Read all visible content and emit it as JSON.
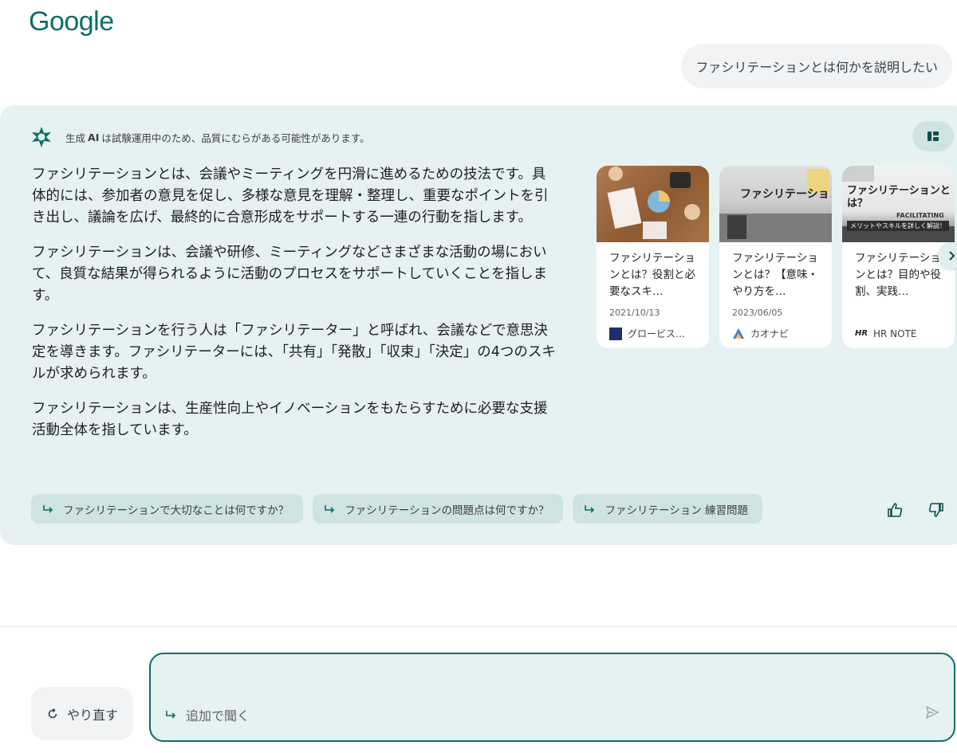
{
  "brand": {
    "logo_text": "Google",
    "accent": "#0b6e6a",
    "panel_bg": "#e6f1f1"
  },
  "user_query": "ファシリテーションとは何かを説明したい",
  "notice": {
    "icon": "sparkle-icon",
    "prefix": "生成",
    "bold": "AI",
    "suffix": "は試験運用中のため、品質にむらがある可能性があります。"
  },
  "answer": {
    "paragraphs": [
      "ファシリテーションとは、会議やミーティングを円滑に進めるための技法です。具体的には、参加者の意見を促し、多様な意見を理解・整理し、重要なポイントを引き出し、議論を広げ、最終的に合意形成をサポートする一連の行動を指します。",
      "ファシリテーションは、会議や研修、ミーティングなどさまざまな活動の場において、良質な結果が得られるように活動のプロセスをサポートしていくことを指します。",
      "ファシリテーションを行う人は「ファシリテーター」と呼ばれ、会議などで意思決定を導きます。ファシリテーターには、「共有」「発散」「収束」「決定」の4つのスキルが求められます。",
      "ファシリテーションは、生産性向上やイノベーションをもたらすために必要な支援活動全体を指しています。"
    ]
  },
  "cards": [
    {
      "title": "ファシリテーションとは？役割と必要なスキ…",
      "date": "2021/10/13",
      "source": "グロービス…",
      "thumb_text": ""
    },
    {
      "title": "ファシリテーションとは？【意味・やり方を…",
      "date": "2023/06/05",
      "source": "カオナビ",
      "thumb_text": "ファシリテーションとは？"
    },
    {
      "title": "ファシリテーションとは？目的や役割、実践…",
      "date": "",
      "source": "HR NOTE",
      "thumb_text": "ファシリテーションとは？",
      "thumb_sub": "FACILITATING",
      "thumb_banner": "メリットやスキルを詳しく解説！"
    }
  ],
  "source_icon_text": {
    "hr": "HR"
  },
  "followups": [
    "ファシリテーションで大切なことは何ですか？",
    "ファシリテーションの問題点は何ですか？",
    "ファシリテーション 練習問題"
  ],
  "retry_label": "やり直す",
  "ask_placeholder": "追加で聞く"
}
